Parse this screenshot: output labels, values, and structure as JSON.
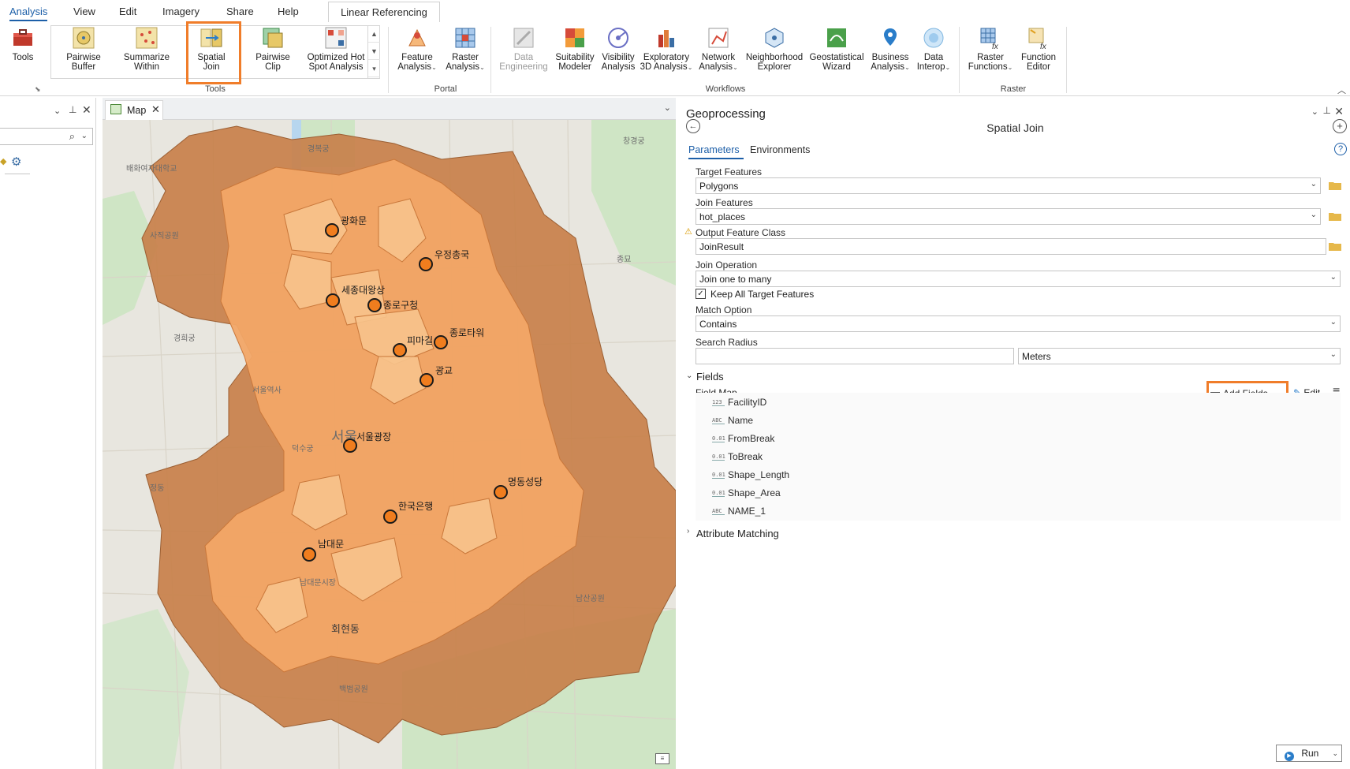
{
  "ribbon": {
    "tabs": [
      "Analysis",
      "View",
      "Edit",
      "Imagery",
      "Share",
      "Help"
    ],
    "active_tab": "Analysis",
    "contextual_tab": "Linear Referencing",
    "tools_button": "Tools",
    "gallery": [
      {
        "l1": "Pairwise",
        "l2": "Buffer"
      },
      {
        "l1": "Summarize",
        "l2": "Within"
      },
      {
        "l1": "Spatial",
        "l2": "Join"
      },
      {
        "l1": "Pairwise",
        "l2": "Clip"
      },
      {
        "l1": "Optimized Hot",
        "l2": "Spot Analysis"
      }
    ],
    "portal": [
      {
        "l1": "Feature",
        "l2": "Analysis"
      },
      {
        "l1": "Raster",
        "l2": "Analysis"
      }
    ],
    "workflows": [
      {
        "l1": "Data",
        "l2": "Engineering"
      },
      {
        "l1": "Suitability",
        "l2": "Modeler"
      },
      {
        "l1": "Visibility",
        "l2": "Analysis"
      },
      {
        "l1": "Exploratory",
        "l2": "3D Analysis"
      },
      {
        "l1": "Network",
        "l2": "Analysis"
      },
      {
        "l1": "Neighborhood",
        "l2": "Explorer"
      },
      {
        "l1": "Geostatistical",
        "l2": "Wizard"
      },
      {
        "l1": "Business",
        "l2": "Analysis"
      },
      {
        "l1": "Data",
        "l2": "Interop"
      }
    ],
    "raster": [
      {
        "l1": "Raster",
        "l2": "Functions"
      },
      {
        "l1": "Function",
        "l2": "Editor"
      }
    ],
    "groups": {
      "tools": "Tools",
      "portal": "Portal",
      "workflows": "Workflows",
      "raster": "Raster"
    }
  },
  "map": {
    "tab_label": "Map",
    "places": [
      "광화문",
      "우정총국",
      "세종대왕상",
      "종로구청",
      "피마길",
      "종로타워",
      "광교",
      "서울광장",
      "명동성당",
      "한국은행",
      "남대문"
    ],
    "basemap_labels": [
      "경복궁",
      "창경궁",
      "배화여자대학교",
      "사직공원",
      "종묘",
      "경희궁",
      "서울역사",
      "덕수궁",
      "서울",
      "회현동",
      "남산공원",
      "백범공원",
      "정동",
      "남대문시장"
    ],
    "colors": {
      "outer": "#c8804a",
      "mid": "#f2a767",
      "inner": "#f7c38c",
      "point": "#f07d1e"
    }
  },
  "gp": {
    "title": "Geoprocessing",
    "tool": "Spatial Join",
    "tabs": [
      "Parameters",
      "Environments"
    ],
    "target_label": "Target Features",
    "target_value": "Polygons",
    "join_label": "Join Features",
    "join_value": "hot_places",
    "output_label": "Output Feature Class",
    "output_value": "JoinResult",
    "operation_label": "Join Operation",
    "operation_value": "Join one to many",
    "keep_all": "Keep All Target Features",
    "match_label": "Match Option",
    "match_value": "Contains",
    "radius_label": "Search Radius",
    "radius_value": "",
    "radius_unit": "Meters",
    "fields_section": "Fields",
    "field_map_label": "Field Map",
    "add_fields": "Add Fields",
    "edit": "Edit",
    "fields": [
      {
        "type": "123",
        "name": "FacilityID"
      },
      {
        "type": "ABC",
        "name": "Name"
      },
      {
        "type": "0.01",
        "name": "FromBreak"
      },
      {
        "type": "0.01",
        "name": "ToBreak"
      },
      {
        "type": "0.01",
        "name": "Shape_Length"
      },
      {
        "type": "0.01",
        "name": "Shape_Area"
      },
      {
        "type": "ABC",
        "name": "NAME_1"
      }
    ],
    "attribute_matching": "Attribute Matching",
    "run": "Run",
    "accent": "#f07d2a"
  }
}
